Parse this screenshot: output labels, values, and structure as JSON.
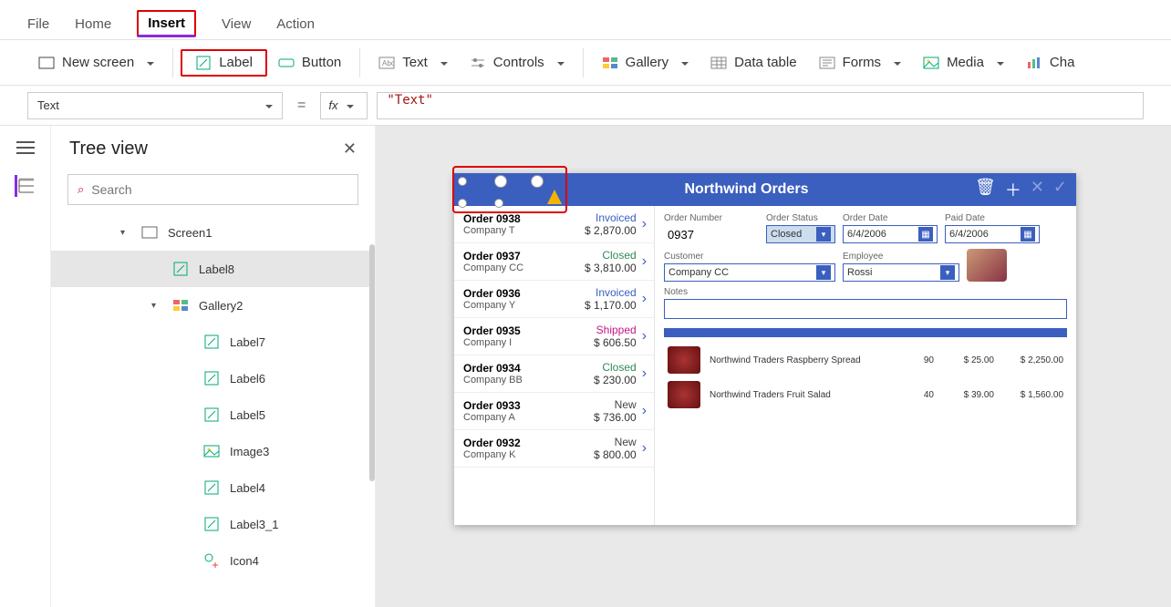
{
  "menubar": {
    "items": [
      "File",
      "Home",
      "Insert",
      "View",
      "Action"
    ],
    "active": "Insert"
  },
  "ribbon": {
    "new_screen": "New screen",
    "label": "Label",
    "button": "Button",
    "text": "Text",
    "controls": "Controls",
    "gallery": "Gallery",
    "data_table": "Data table",
    "forms": "Forms",
    "media": "Media",
    "charts": "Cha"
  },
  "formula": {
    "property": "Text",
    "fx": "fx",
    "value": "\"Text\""
  },
  "tree": {
    "title": "Tree view",
    "search_placeholder": "Search",
    "items": [
      {
        "level": 1,
        "expander": "◣",
        "icon": "screen",
        "label": "Screen1"
      },
      {
        "level": 2,
        "icon": "label",
        "label": "Label8",
        "selected": true
      },
      {
        "level": 2,
        "expander": "◣",
        "icon": "gallery",
        "label": "Gallery2"
      },
      {
        "level": 3,
        "icon": "label",
        "label": "Label7"
      },
      {
        "level": 3,
        "icon": "label",
        "label": "Label6"
      },
      {
        "level": 3,
        "icon": "label",
        "label": "Label5"
      },
      {
        "level": 3,
        "icon": "image",
        "label": "Image3"
      },
      {
        "level": 3,
        "icon": "label",
        "label": "Label4"
      },
      {
        "level": 3,
        "icon": "label",
        "label": "Label3_1"
      },
      {
        "level": 3,
        "icon": "icon",
        "label": "Icon4"
      }
    ]
  },
  "app": {
    "title": "Northwind Orders",
    "orders": [
      {
        "num": "Order 0938",
        "company": "Company T",
        "status": "Invoiced",
        "statusClass": "st-invoiced",
        "value": "$ 2,870.00"
      },
      {
        "num": "Order 0937",
        "company": "Company CC",
        "status": "Closed",
        "statusClass": "st-closed",
        "value": "$ 3,810.00"
      },
      {
        "num": "Order 0936",
        "company": "Company Y",
        "status": "Invoiced",
        "statusClass": "st-invoiced",
        "value": "$ 1,170.00"
      },
      {
        "num": "Order 0935",
        "company": "Company I",
        "status": "Shipped",
        "statusClass": "st-shipped",
        "value": "$ 606.50"
      },
      {
        "num": "Order 0934",
        "company": "Company BB",
        "status": "Closed",
        "statusClass": "st-closed",
        "value": "$ 230.00"
      },
      {
        "num": "Order 0933",
        "company": "Company A",
        "status": "New",
        "statusClass": "st-new",
        "value": "$ 736.00"
      },
      {
        "num": "Order 0932",
        "company": "Company K",
        "status": "New",
        "statusClass": "st-new",
        "value": "$ 800.00"
      }
    ],
    "detail": {
      "order_number_label": "Order Number",
      "order_number": "0937",
      "order_status_label": "Order Status",
      "order_status": "Closed",
      "order_date_label": "Order Date",
      "order_date": "6/4/2006",
      "paid_date_label": "Paid Date",
      "paid_date": "6/4/2006",
      "customer_label": "Customer",
      "customer": "Company CC",
      "employee_label": "Employee",
      "employee": "Rossi",
      "notes_label": "Notes"
    },
    "lines": [
      {
        "name": "Northwind Traders Raspberry Spread",
        "qty": "90",
        "price": "$ 25.00",
        "total": "$ 2,250.00"
      },
      {
        "name": "Northwind Traders Fruit Salad",
        "qty": "40",
        "price": "$ 39.00",
        "total": "$ 1,560.00"
      }
    ]
  }
}
